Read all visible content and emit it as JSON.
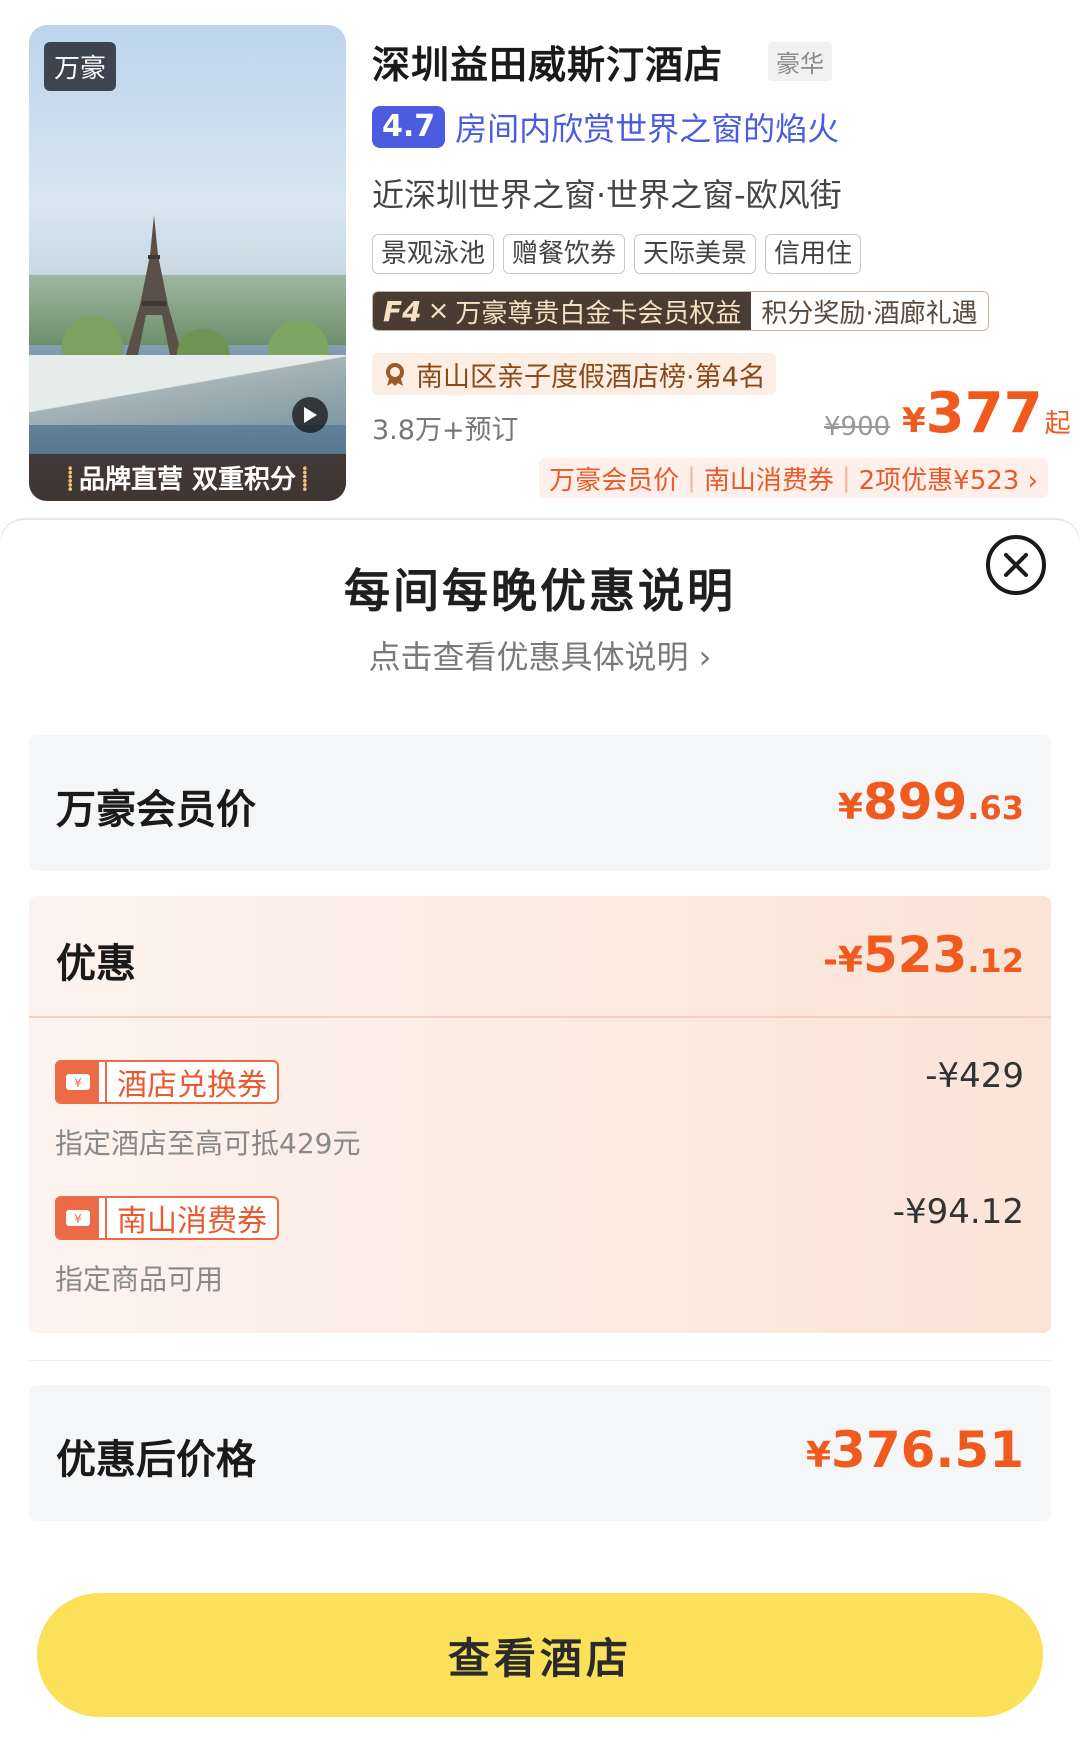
{
  "hotel": {
    "brand_badge": "万豪",
    "thumb_footer": "品牌直营 双重积分",
    "name": "深圳益田威斯汀酒店",
    "star": "豪华",
    "rating": "4.7",
    "rating_text": "房间内欣赏世界之窗的焰火",
    "location": "近深圳世界之窗·世界之窗-欧风街",
    "tags": [
      "景观泳池",
      "赠餐饮券",
      "天际美景",
      "信用住"
    ],
    "member_left_logo": "F4",
    "member_left_x": "×",
    "member_left_text": "万豪尊贵白金卡会员权益",
    "member_right_text": "积分奖励·酒廊礼遇",
    "rank_text": "南山区亲子度假酒店榜·第4名",
    "booked": "3.8万+预订",
    "original_price": "¥900",
    "price_symbol": "¥",
    "price": "377",
    "price_suffix": "起",
    "promo": [
      "万豪会员价",
      "南山消费券",
      "2项优惠¥523 ›"
    ]
  },
  "sheet": {
    "title": "每间每晚优惠说明",
    "subtitle": "点击查看优惠具体说明 ›",
    "member_price_label": "万豪会员价",
    "member_price_symbol": "¥",
    "member_price_int": "899",
    "member_price_dec": ".63",
    "discount_label": "优惠",
    "discount_symbol": "-¥",
    "discount_int": "523",
    "discount_dec": ".12",
    "coupons": [
      {
        "name": "酒店兑换券",
        "desc": "指定酒店至高可抵429元",
        "amount": "-¥429"
      },
      {
        "name": "南山消费券",
        "desc": "指定商品可用",
        "amount": "-¥94.12"
      }
    ],
    "final_label": "优惠后价格",
    "final_symbol": "¥",
    "final_price": "376.51",
    "cta": "查看酒店"
  },
  "colors": {
    "accent_orange": "#f05a1e",
    "rating_blue": "#4b5ce0",
    "cta_yellow": "#fbe05a"
  }
}
